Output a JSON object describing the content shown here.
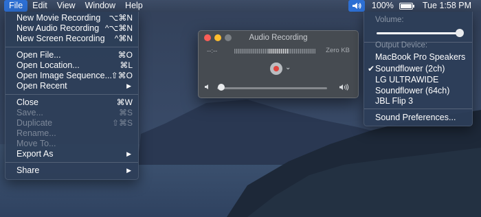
{
  "menubar": {
    "items": [
      "File",
      "Edit",
      "View",
      "Window",
      "Help"
    ],
    "battery": "100%",
    "clock": "Tue 1:58 PM"
  },
  "file_menu": {
    "items": [
      {
        "label": "New Movie Recording",
        "shortcut": "⌥⌘N"
      },
      {
        "label": "New Audio Recording",
        "shortcut": "^⌥⌘N"
      },
      {
        "label": "New Screen Recording",
        "shortcut": "^⌘N"
      },
      {
        "label": "Open File...",
        "shortcut": "⌘O"
      },
      {
        "label": "Open Location...",
        "shortcut": "⌘L"
      },
      {
        "label": "Open Image Sequence...",
        "shortcut": "⇧⌘O"
      },
      {
        "label": "Open Recent"
      },
      {
        "label": "Close",
        "shortcut": "⌘W"
      },
      {
        "label": "Save...",
        "shortcut": "⌘S"
      },
      {
        "label": "Duplicate",
        "shortcut": "⇧⌘S"
      },
      {
        "label": "Rename..."
      },
      {
        "label": "Move To..."
      },
      {
        "label": "Export As"
      },
      {
        "label": "Share"
      }
    ]
  },
  "recording_window": {
    "title": "Audio Recording",
    "time": "--:--",
    "file_size": "Zero KB",
    "volume_level": 0.02,
    "colors": {
      "record": "#e0443e"
    }
  },
  "volume_menu": {
    "volume_label": "Volume:",
    "volume_level": 0.95,
    "output_label": "Output Device:",
    "devices": [
      "MacBook Pro Speakers",
      "Soundflower (2ch)",
      "LG ULTRAWIDE",
      "Soundflower (64ch)",
      "JBL Flip 3"
    ],
    "selected": "Soundflower (2ch)",
    "preferences": "Sound Preferences..."
  }
}
